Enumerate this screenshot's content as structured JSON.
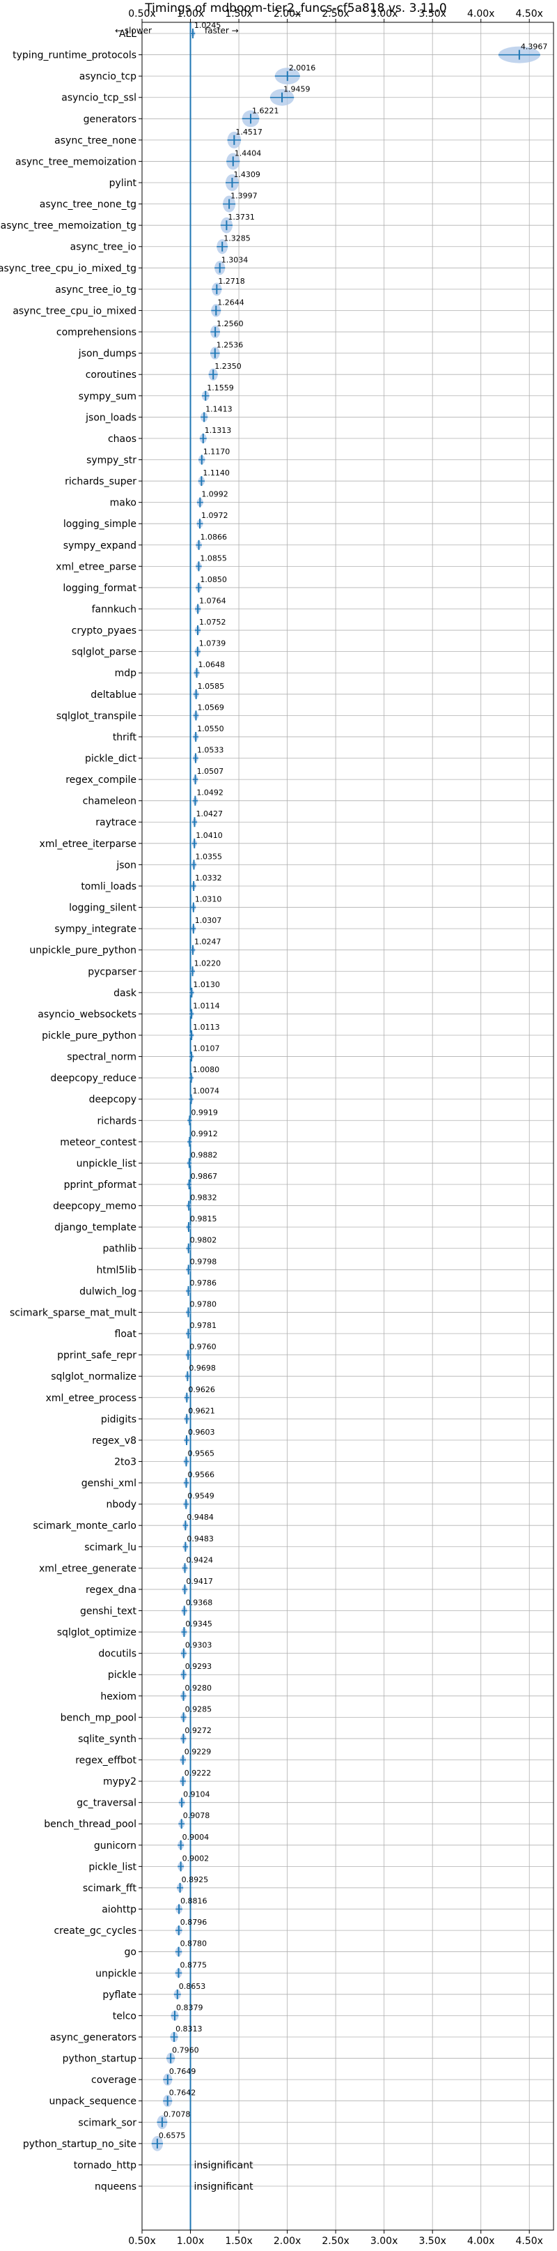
{
  "chart_data": {
    "type": "violin",
    "title": "Timings of mdboom-tier2_funcs-cf5a818 vs. 3.11.0",
    "legend_slower": "← slower",
    "legend_faster": "faster →",
    "xlim": [
      0.5,
      4.75
    ],
    "xticks": [
      "0.50x",
      "1.00x",
      "1.50x",
      "2.00x",
      "2.50x",
      "3.00x",
      "3.50x",
      "4.00x",
      "4.50x"
    ],
    "xtick_values": [
      0.5,
      1.0,
      1.5,
      2.0,
      2.5,
      3.0,
      3.5,
      4.0,
      4.5
    ],
    "reference_line": 1.0,
    "grid": true,
    "insignificant_label": "insignificant",
    "benchmarks": [
      {
        "name": "ALL",
        "value": 1.0245,
        "label": "1.0245"
      },
      {
        "name": "typing_runtime_protocols",
        "value": 4.3967,
        "label": "4.3967"
      },
      {
        "name": "asyncio_tcp",
        "value": 2.0016,
        "label": "2.0016"
      },
      {
        "name": "asyncio_tcp_ssl",
        "value": 1.9459,
        "label": "1.9459"
      },
      {
        "name": "generators",
        "value": 1.6221,
        "label": "1.6221"
      },
      {
        "name": "async_tree_none",
        "value": 1.4517,
        "label": "1.4517"
      },
      {
        "name": "async_tree_memoization",
        "value": 1.4404,
        "label": "1.4404"
      },
      {
        "name": "pylint",
        "value": 1.4309,
        "label": "1.4309"
      },
      {
        "name": "async_tree_none_tg",
        "value": 1.3997,
        "label": "1.3997"
      },
      {
        "name": "async_tree_memoization_tg",
        "value": 1.3731,
        "label": "1.3731"
      },
      {
        "name": "async_tree_io",
        "value": 1.3285,
        "label": "1.3285"
      },
      {
        "name": "async_tree_cpu_io_mixed_tg",
        "value": 1.3034,
        "label": "1.3034"
      },
      {
        "name": "async_tree_io_tg",
        "value": 1.2718,
        "label": "1.2718"
      },
      {
        "name": "async_tree_cpu_io_mixed",
        "value": 1.2644,
        "label": "1.2644"
      },
      {
        "name": "comprehensions",
        "value": 1.256,
        "label": "1.2560"
      },
      {
        "name": "json_dumps",
        "value": 1.2536,
        "label": "1.2536"
      },
      {
        "name": "coroutines",
        "value": 1.235,
        "label": "1.2350"
      },
      {
        "name": "sympy_sum",
        "value": 1.1559,
        "label": "1.1559"
      },
      {
        "name": "json_loads",
        "value": 1.1413,
        "label": "1.1413"
      },
      {
        "name": "chaos",
        "value": 1.1313,
        "label": "1.1313"
      },
      {
        "name": "sympy_str",
        "value": 1.117,
        "label": "1.1170"
      },
      {
        "name": "richards_super",
        "value": 1.114,
        "label": "1.1140"
      },
      {
        "name": "mako",
        "value": 1.0992,
        "label": "1.0992"
      },
      {
        "name": "logging_simple",
        "value": 1.0972,
        "label": "1.0972"
      },
      {
        "name": "sympy_expand",
        "value": 1.0866,
        "label": "1.0866"
      },
      {
        "name": "xml_etree_parse",
        "value": 1.0855,
        "label": "1.0855"
      },
      {
        "name": "logging_format",
        "value": 1.085,
        "label": "1.0850"
      },
      {
        "name": "fannkuch",
        "value": 1.0764,
        "label": "1.0764"
      },
      {
        "name": "crypto_pyaes",
        "value": 1.0752,
        "label": "1.0752"
      },
      {
        "name": "sqlglot_parse",
        "value": 1.0739,
        "label": "1.0739"
      },
      {
        "name": "mdp",
        "value": 1.0648,
        "label": "1.0648"
      },
      {
        "name": "deltablue",
        "value": 1.0585,
        "label": "1.0585"
      },
      {
        "name": "sqlglot_transpile",
        "value": 1.0569,
        "label": "1.0569"
      },
      {
        "name": "thrift",
        "value": 1.055,
        "label": "1.0550"
      },
      {
        "name": "pickle_dict",
        "value": 1.0533,
        "label": "1.0533"
      },
      {
        "name": "regex_compile",
        "value": 1.0507,
        "label": "1.0507"
      },
      {
        "name": "chameleon",
        "value": 1.0492,
        "label": "1.0492"
      },
      {
        "name": "raytrace",
        "value": 1.0427,
        "label": "1.0427"
      },
      {
        "name": "xml_etree_iterparse",
        "value": 1.041,
        "label": "1.0410"
      },
      {
        "name": "json",
        "value": 1.0355,
        "label": "1.0355"
      },
      {
        "name": "tomli_loads",
        "value": 1.0332,
        "label": "1.0332"
      },
      {
        "name": "logging_silent",
        "value": 1.031,
        "label": "1.0310"
      },
      {
        "name": "sympy_integrate",
        "value": 1.0307,
        "label": "1.0307"
      },
      {
        "name": "unpickle_pure_python",
        "value": 1.0247,
        "label": "1.0247"
      },
      {
        "name": "pycparser",
        "value": 1.022,
        "label": "1.0220"
      },
      {
        "name": "dask",
        "value": 1.013,
        "label": "1.0130"
      },
      {
        "name": "asyncio_websockets",
        "value": 1.0114,
        "label": "1.0114"
      },
      {
        "name": "pickle_pure_python",
        "value": 1.0113,
        "label": "1.0113"
      },
      {
        "name": "spectral_norm",
        "value": 1.0107,
        "label": "1.0107"
      },
      {
        "name": "deepcopy_reduce",
        "value": 1.008,
        "label": "1.0080"
      },
      {
        "name": "deepcopy",
        "value": 1.0074,
        "label": "1.0074"
      },
      {
        "name": "richards",
        "value": 0.9919,
        "label": "0.9919"
      },
      {
        "name": "meteor_contest",
        "value": 0.9912,
        "label": "0.9912"
      },
      {
        "name": "unpickle_list",
        "value": 0.9882,
        "label": "0.9882"
      },
      {
        "name": "pprint_pformat",
        "value": 0.9867,
        "label": "0.9867"
      },
      {
        "name": "deepcopy_memo",
        "value": 0.9832,
        "label": "0.9832"
      },
      {
        "name": "django_template",
        "value": 0.9815,
        "label": "0.9815"
      },
      {
        "name": "pathlib",
        "value": 0.9802,
        "label": "0.9802"
      },
      {
        "name": "html5lib",
        "value": 0.9798,
        "label": "0.9798"
      },
      {
        "name": "dulwich_log",
        "value": 0.9786,
        "label": "0.9786"
      },
      {
        "name": "scimark_sparse_mat_mult",
        "value": 0.978,
        "label": "0.9780"
      },
      {
        "name": "float",
        "value": 0.9781,
        "label": "0.9781"
      },
      {
        "name": "pprint_safe_repr",
        "value": 0.976,
        "label": "0.9760"
      },
      {
        "name": "sqlglot_normalize",
        "value": 0.9698,
        "label": "0.9698"
      },
      {
        "name": "xml_etree_process",
        "value": 0.9626,
        "label": "0.9626"
      },
      {
        "name": "pidigits",
        "value": 0.9621,
        "label": "0.9621"
      },
      {
        "name": "regex_v8",
        "value": 0.9603,
        "label": "0.9603"
      },
      {
        "name": "2to3",
        "value": 0.9565,
        "label": "0.9565"
      },
      {
        "name": "genshi_xml",
        "value": 0.9566,
        "label": "0.9566"
      },
      {
        "name": "nbody",
        "value": 0.9549,
        "label": "0.9549"
      },
      {
        "name": "scimark_monte_carlo",
        "value": 0.9484,
        "label": "0.9484"
      },
      {
        "name": "scimark_lu",
        "value": 0.9483,
        "label": "0.9483"
      },
      {
        "name": "xml_etree_generate",
        "value": 0.9424,
        "label": "0.9424"
      },
      {
        "name": "regex_dna",
        "value": 0.9417,
        "label": "0.9417"
      },
      {
        "name": "genshi_text",
        "value": 0.9368,
        "label": "0.9368"
      },
      {
        "name": "sqlglot_optimize",
        "value": 0.9345,
        "label": "0.9345"
      },
      {
        "name": "docutils",
        "value": 0.9303,
        "label": "0.9303"
      },
      {
        "name": "pickle",
        "value": 0.9293,
        "label": "0.9293"
      },
      {
        "name": "hexiom",
        "value": 0.928,
        "label": "0.9280"
      },
      {
        "name": "bench_mp_pool",
        "value": 0.9285,
        "label": "0.9285"
      },
      {
        "name": "sqlite_synth",
        "value": 0.9272,
        "label": "0.9272"
      },
      {
        "name": "regex_effbot",
        "value": 0.9229,
        "label": "0.9229"
      },
      {
        "name": "mypy2",
        "value": 0.9222,
        "label": "0.9222"
      },
      {
        "name": "gc_traversal",
        "value": 0.9104,
        "label": "0.9104"
      },
      {
        "name": "bench_thread_pool",
        "value": 0.9078,
        "label": "0.9078"
      },
      {
        "name": "gunicorn",
        "value": 0.9004,
        "label": "0.9004"
      },
      {
        "name": "pickle_list",
        "value": 0.9002,
        "label": "0.9002"
      },
      {
        "name": "scimark_fft",
        "value": 0.8925,
        "label": "0.8925"
      },
      {
        "name": "aiohttp",
        "value": 0.8816,
        "label": "0.8816"
      },
      {
        "name": "create_gc_cycles",
        "value": 0.8796,
        "label": "0.8796"
      },
      {
        "name": "go",
        "value": 0.878,
        "label": "0.8780"
      },
      {
        "name": "unpickle",
        "value": 0.8775,
        "label": "0.8775"
      },
      {
        "name": "pyflate",
        "value": 0.8653,
        "label": "0.8653"
      },
      {
        "name": "telco",
        "value": 0.8379,
        "label": "0.8379"
      },
      {
        "name": "async_generators",
        "value": 0.8313,
        "label": "0.8313"
      },
      {
        "name": "python_startup",
        "value": 0.796,
        "label": "0.7960"
      },
      {
        "name": "coverage",
        "value": 0.7649,
        "label": "0.7649"
      },
      {
        "name": "unpack_sequence",
        "value": 0.7642,
        "label": "0.7642"
      },
      {
        "name": "scimark_sor",
        "value": 0.7078,
        "label": "0.7078"
      },
      {
        "name": "python_startup_no_site",
        "value": 0.6575,
        "label": "0.6575"
      },
      {
        "name": "tornado_http",
        "value": null,
        "label": "insignificant"
      },
      {
        "name": "nqueens",
        "value": null,
        "label": "insignificant"
      }
    ],
    "colors": {
      "violin": "#aec7e8",
      "marker": "#1f77b4",
      "reference": "#1f77b4",
      "grid": "#b0b0b0",
      "median": "#d62728"
    }
  }
}
